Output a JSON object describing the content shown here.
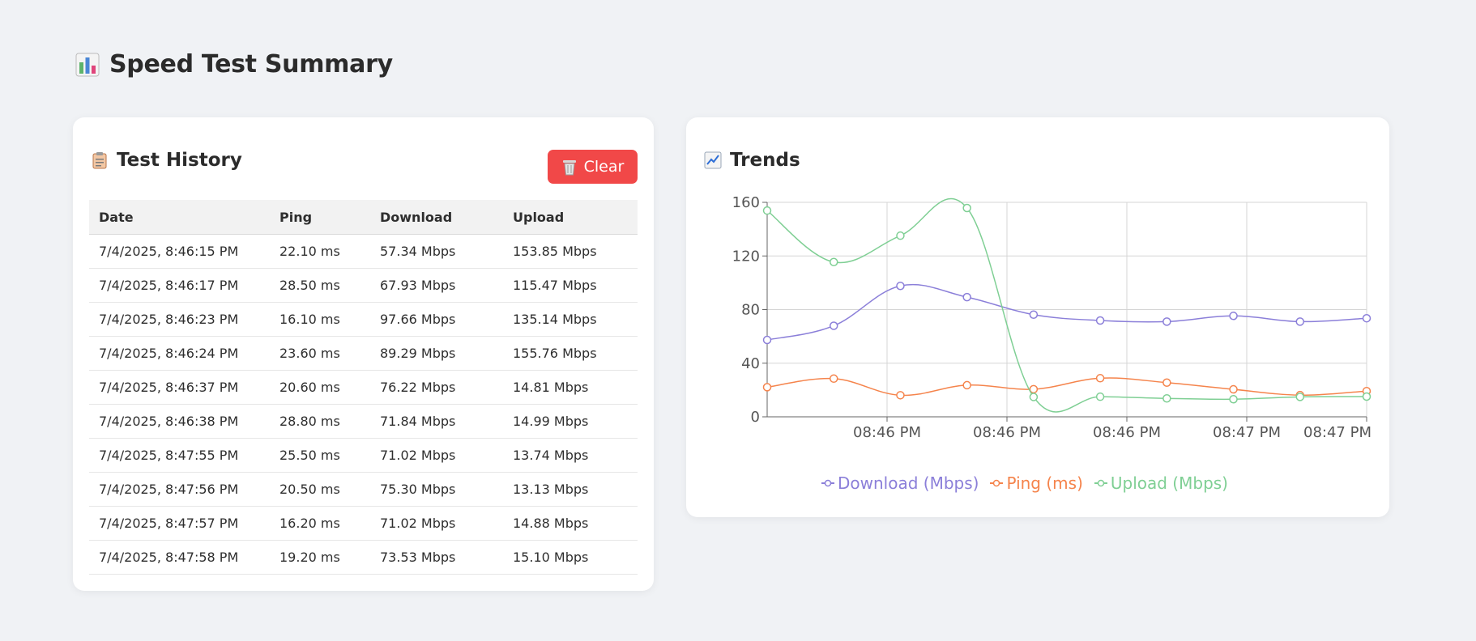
{
  "page": {
    "title": "Speed Test Summary",
    "icon": "bar-chart-icon"
  },
  "history": {
    "title": "Test History",
    "icon": "clipboard-icon",
    "clear_button": {
      "label": "Clear",
      "icon": "wastebasket-icon",
      "color": "#f14848"
    },
    "columns": [
      "Date",
      "Ping",
      "Download",
      "Upload"
    ],
    "rows": [
      [
        "7/4/2025, 8:46:15 PM",
        "22.10 ms",
        "57.34 Mbps",
        "153.85 Mbps"
      ],
      [
        "7/4/2025, 8:46:17 PM",
        "28.50 ms",
        "67.93 Mbps",
        "115.47 Mbps"
      ],
      [
        "7/4/2025, 8:46:23 PM",
        "16.10 ms",
        "97.66 Mbps",
        "135.14 Mbps"
      ],
      [
        "7/4/2025, 8:46:24 PM",
        "23.60 ms",
        "89.29 Mbps",
        "155.76 Mbps"
      ],
      [
        "7/4/2025, 8:46:37 PM",
        "20.60 ms",
        "76.22 Mbps",
        "14.81 Mbps"
      ],
      [
        "7/4/2025, 8:46:38 PM",
        "28.80 ms",
        "71.84 Mbps",
        "14.99 Mbps"
      ],
      [
        "7/4/2025, 8:47:55 PM",
        "25.50 ms",
        "71.02 Mbps",
        "13.74 Mbps"
      ],
      [
        "7/4/2025, 8:47:56 PM",
        "20.50 ms",
        "75.30 Mbps",
        "13.13 Mbps"
      ],
      [
        "7/4/2025, 8:47:57 PM",
        "16.20 ms",
        "71.02 Mbps",
        "14.88 Mbps"
      ],
      [
        "7/4/2025, 8:47:58 PM",
        "19.20 ms",
        "73.53 Mbps",
        "15.10 Mbps"
      ]
    ]
  },
  "trends": {
    "title": "Trends",
    "icon": "chart-increasing-icon"
  },
  "chart_data": {
    "type": "line",
    "x_tick_labels": [
      "08:46 PM",
      "08:46 PM",
      "08:46 PM",
      "08:47 PM",
      "08:47 PM"
    ],
    "ylim": [
      0,
      160
    ],
    "y_ticks": [
      0,
      40,
      80,
      120,
      160
    ],
    "grid": true,
    "legend_position": "bottom",
    "series": [
      {
        "name": "Download (Mbps)",
        "color": "#8b7fd9",
        "values": [
          57.34,
          67.93,
          97.66,
          89.29,
          76.22,
          71.84,
          71.02,
          75.3,
          71.02,
          73.53
        ]
      },
      {
        "name": "Ping (ms)",
        "color": "#f5844c",
        "values": [
          22.1,
          28.5,
          16.1,
          23.6,
          20.6,
          28.8,
          25.5,
          20.5,
          16.2,
          19.2
        ]
      },
      {
        "name": "Upload (Mbps)",
        "color": "#7fcf94",
        "values": [
          153.85,
          115.47,
          135.14,
          155.76,
          14.81,
          14.99,
          13.74,
          13.13,
          14.88,
          15.1
        ]
      }
    ]
  }
}
